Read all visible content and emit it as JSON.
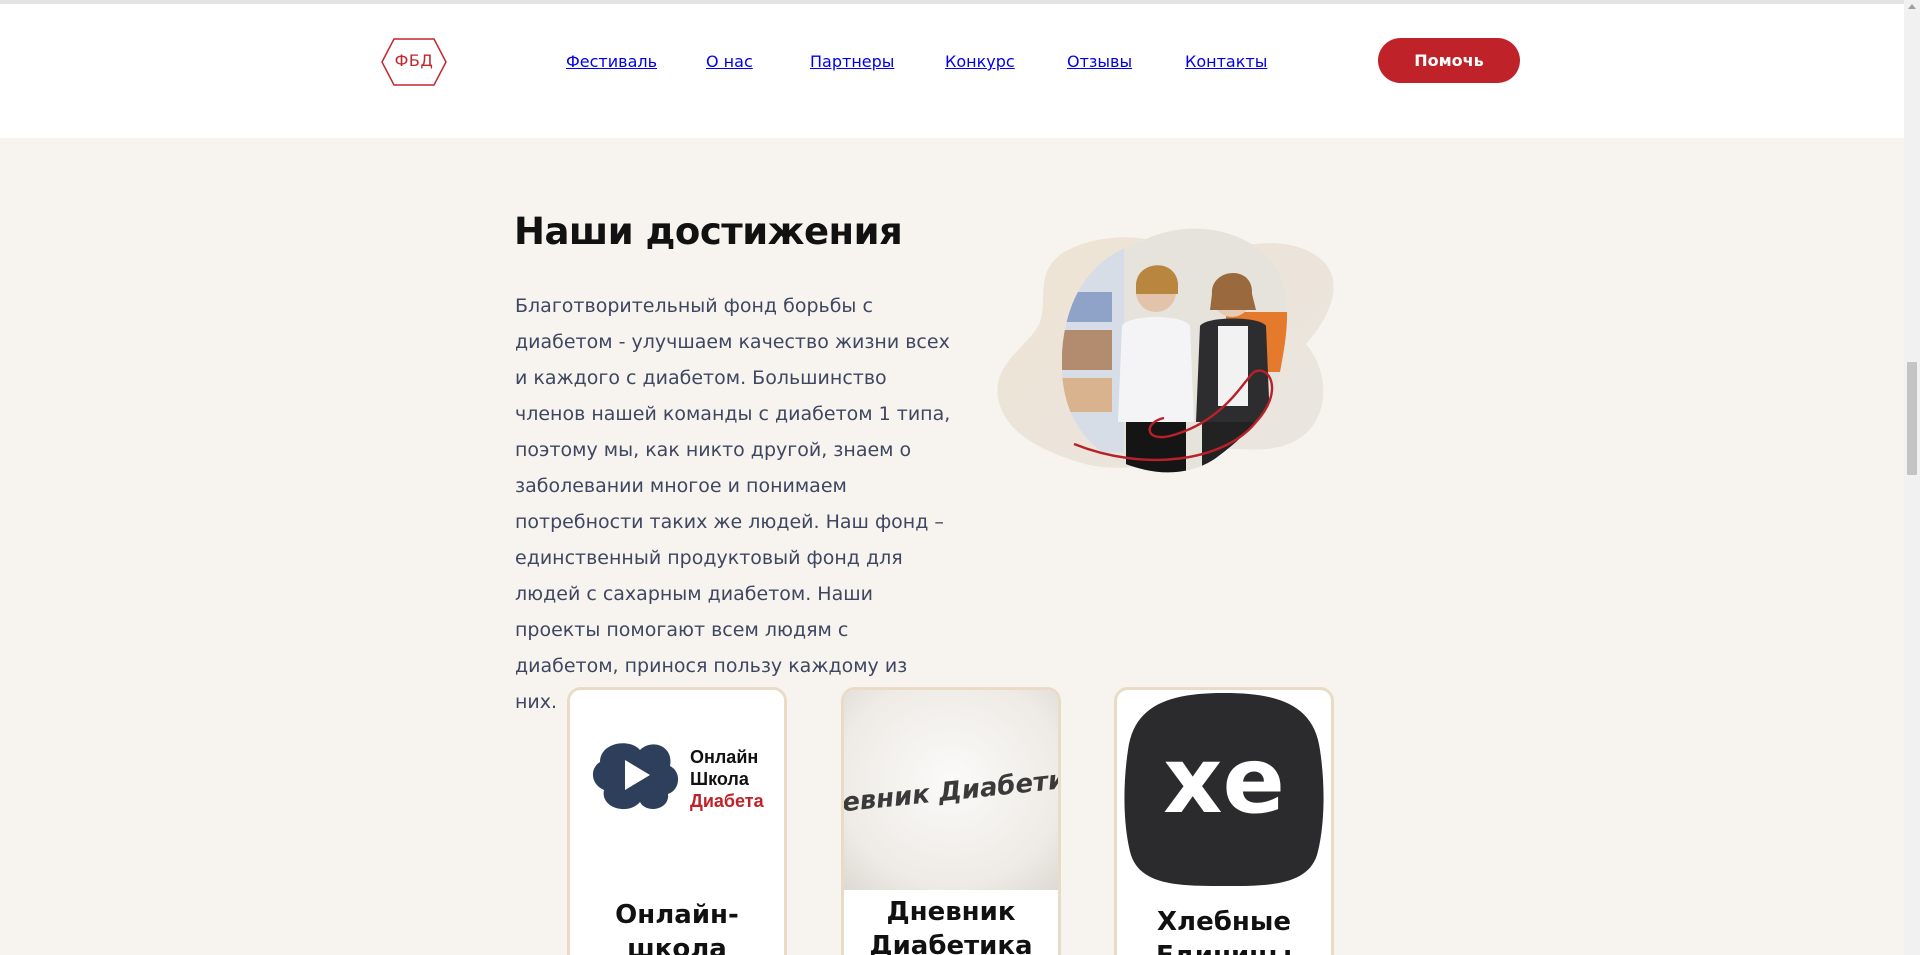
{
  "logo": {
    "text": "ФБД"
  },
  "nav": {
    "items": [
      {
        "label": "Фестиваль"
      },
      {
        "label": "О нас"
      },
      {
        "label": "Партнеры"
      },
      {
        "label": "Конкурс"
      },
      {
        "label": "Отзывы"
      },
      {
        "label": "Контакты"
      }
    ],
    "cta_label": "Помочь"
  },
  "achievements": {
    "title": "Наши достижения",
    "text": "Благотворительный фонд борьбы с диабетом - улучшаем качество жизни всех и каждого с диабетом. Большинство членов нашей команды с диабетом 1 типа, поэтому мы, как никто другой, знаем о заболевании многое и понимаем потребности таких же людей. Наш фонд – единственный продуктовый фонд для людей с сахарным диабетом. Наши проекты помогают всем людям с диабетом, принося пользу каждому из них."
  },
  "cards": [
    {
      "title": "Онлайн-школа диабета",
      "logo_lines": [
        "Онлайн",
        "Школа",
        "Диабета"
      ]
    },
    {
      "title": "Дневник Диабетика",
      "logo_text": "Дневник Диабетика"
    },
    {
      "title": "Хлебные Единицы",
      "logo_text": "xe"
    }
  ],
  "colors": {
    "accent": "#bf2229",
    "background": "#f7f4ef",
    "text": "#3f4660",
    "card_border": "#eadbc6",
    "school_blue": "#2e3f5c"
  }
}
